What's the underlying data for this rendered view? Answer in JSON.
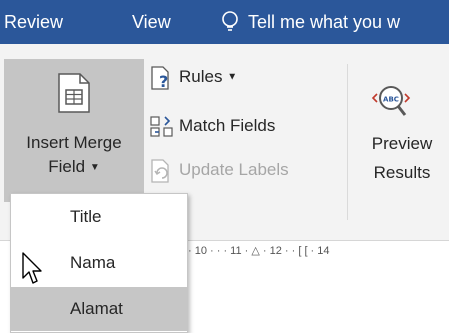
{
  "tabs": {
    "review": "Review",
    "view": "View"
  },
  "tell_me": "Tell me what you w",
  "group": {
    "insert_merge_field": {
      "line1": "Insert Merge",
      "line2": "Field"
    },
    "rules": "Rules",
    "match_fields": "Match Fields",
    "update_labels": "Update Labels",
    "preview": {
      "line1": "Preview",
      "line2": "Results"
    }
  },
  "ruler": "· 10 · · · 11 · △ · 12 · · [ [ · 14",
  "dropdown": {
    "items": [
      {
        "label": "Title"
      },
      {
        "label": "Nama"
      },
      {
        "label": "Alamat"
      }
    ]
  },
  "colors": {
    "ribbon_blue": "#2b579a",
    "hover_gray": "#c5c5c5"
  }
}
